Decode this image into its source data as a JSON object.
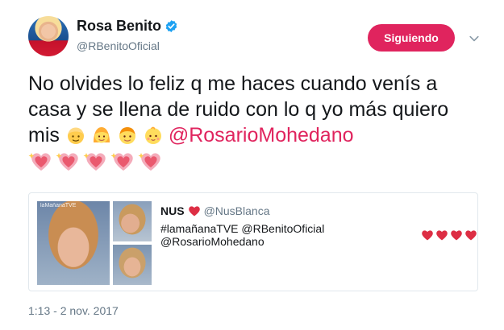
{
  "author": {
    "name": "Rosa Benito",
    "handle": "@RBenitoOficial",
    "verified_icon": "verified-badge-icon"
  },
  "actions": {
    "follow_label": "Siguiendo",
    "caret_icon": "chevron-down-icon"
  },
  "tweet": {
    "text_line": "No olvides lo feliz q me haces cuando venís a casa y se llena de ruido con lo q yo más quiero mis",
    "emojis": [
      "blond-boy-emoji",
      "blond-woman-emoji",
      "boy-emoji",
      "baby-emoji"
    ],
    "mention": "@RosarioMohedano",
    "trailing_emojis": [
      "sparkling-heart-emoji",
      "sparkling-heart-emoji",
      "sparkling-heart-emoji",
      "sparkling-heart-emoji",
      "sparkling-heart-emoji"
    ]
  },
  "quoted_tweet": {
    "name": "NUS",
    "handle": "@NusBlanca",
    "text": "#lamañanaTVE @RBenitoOficial @RosarioMohedano",
    "heart_count_visible": 4,
    "photo_watermark": "laMañanaTVE"
  },
  "timestamp": "1:13 - 2 nov. 2017",
  "colors": {
    "accent": "#e0245e",
    "verified": "#1da1f2",
    "muted": "#657786",
    "heart": "#e0245e"
  }
}
